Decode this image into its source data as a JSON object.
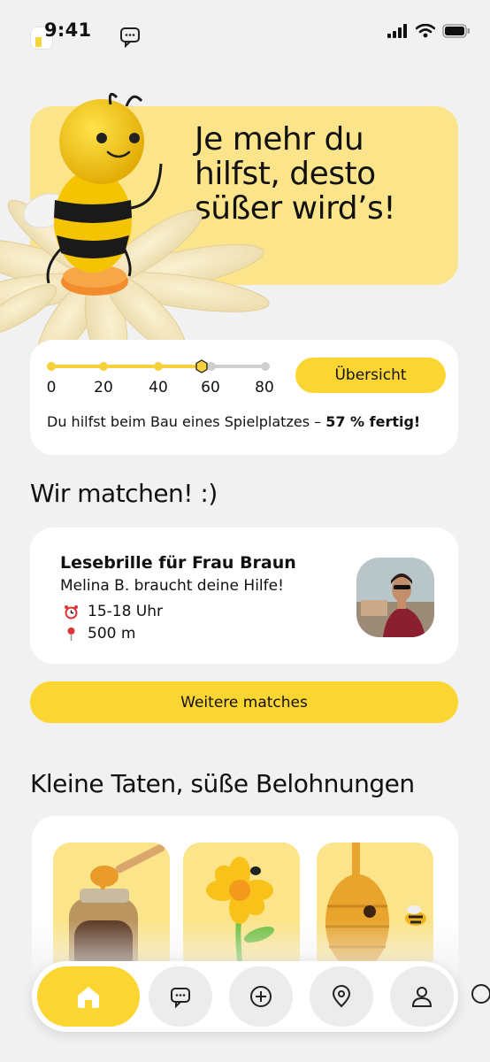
{
  "status_bar": {
    "time": "9:41"
  },
  "hero": {
    "headline_lines": [
      "Je mehr du",
      "hilfst, desto",
      "süßer wird’s!"
    ]
  },
  "progress": {
    "ticks": [
      "0",
      "20",
      "40",
      "60",
      "80"
    ],
    "value_percent": 57,
    "overview_button": "Übersicht",
    "text_prefix": "Du hilfst beim Bau eines Spielplatzes – ",
    "text_bold": "57 % fertig!"
  },
  "matches": {
    "section_title": "Wir matchen! :)",
    "card": {
      "title": "Lesebrille für Frau Braun",
      "subtitle": "Melina B. braucht deine Hilfe!",
      "time_icon": "alarm-clock-icon",
      "time": "15-18 Uhr",
      "distance_icon": "location-pin-icon",
      "distance": "500 m"
    },
    "more_button": "Weitere matches"
  },
  "rewards": {
    "section_title": "Kleine Taten, süße Belohnungen",
    "items": [
      {
        "icon": "honey-jar-icon"
      },
      {
        "icon": "flower-icon"
      },
      {
        "icon": "beehive-icon"
      }
    ]
  },
  "tab_bar": {
    "items": [
      {
        "name": "home",
        "icon": "home-icon",
        "active": true
      },
      {
        "name": "messages",
        "icon": "chat-icon",
        "active": false
      },
      {
        "name": "add",
        "icon": "plus-circle-icon",
        "active": false
      },
      {
        "name": "map",
        "icon": "map-pin-icon",
        "active": false
      },
      {
        "name": "profile",
        "icon": "user-icon",
        "active": false
      }
    ]
  },
  "colors": {
    "accent": "#fbd532",
    "hero_bg": "#fbe48a",
    "background": "#f1f1f2",
    "card": "#ffffff"
  }
}
